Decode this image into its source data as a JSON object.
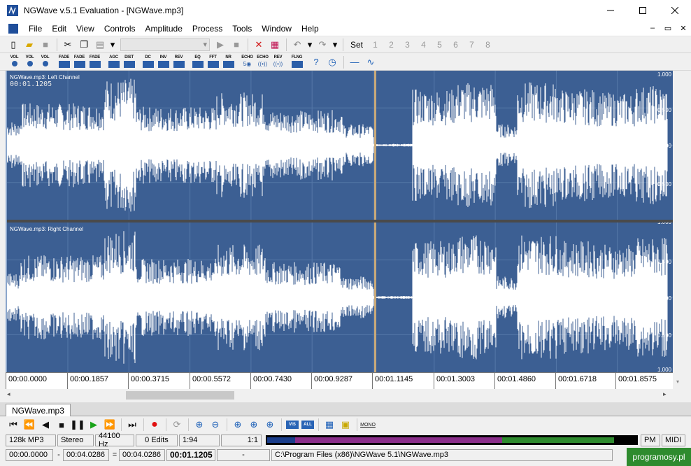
{
  "window": {
    "title": "NGWave v.5.1 Evaluation - [NGWave.mp3]"
  },
  "menu": [
    "File",
    "Edit",
    "View",
    "Controls",
    "Amplitude",
    "Process",
    "Tools",
    "Window",
    "Help"
  ],
  "toolbar": {
    "set_label": "Set",
    "set_numbers": [
      "1",
      "2",
      "3",
      "4",
      "5",
      "6",
      "7",
      "8"
    ]
  },
  "effects": [
    "VOL",
    "VOL",
    "VOL",
    "FADE",
    "FADE",
    "FADE",
    "AGC",
    "DIST",
    "DC",
    "INV",
    "REV",
    "EQ",
    "FFT",
    "NR",
    "ECHO",
    "ECHO",
    "REV",
    "FLNG"
  ],
  "channels": [
    {
      "label": "NGWave.mp3: Left Channel",
      "time": "00:01.1205"
    },
    {
      "label": "NGWave.mp3: Right Channel"
    }
  ],
  "db_scale": [
    "1.000",
    "0.500",
    "0.000",
    "0.500",
    "1.000"
  ],
  "ruler": [
    "00:00.0000",
    "00:00.1857",
    "00:00.3715",
    "00:00.5572",
    "00:00.7430",
    "00:00.9287",
    "00:01.1145",
    "00:01.3003",
    "00:01.4860",
    "00:01.6718",
    "00:01.8575"
  ],
  "tab": "NGWave.mp3",
  "transport_tags": [
    "VIS",
    "ALL",
    "MONO"
  ],
  "status1": {
    "bitrate": "128k MP3",
    "mode": "Stereo",
    "rate": "44100 Hz",
    "edits": "0 Edits",
    "length": "1:94",
    "ratio": "1:1",
    "pm": "PM",
    "midi": "MIDI"
  },
  "status2": {
    "sel_start": "00:00.0000",
    "sel_end": "00:04.0286",
    "sel_len": "00:04.0286",
    "cursor": "00:01.1205",
    "dash": "-",
    "path": "C:\\Program Files (x86)\\NGWave 5.1\\NGWave.mp3"
  },
  "watermark": "programosy.pl",
  "colors": {
    "wave_bg": "#3c5f93",
    "wave_fg": "#ffffff",
    "cursor": "#c8a97a"
  }
}
